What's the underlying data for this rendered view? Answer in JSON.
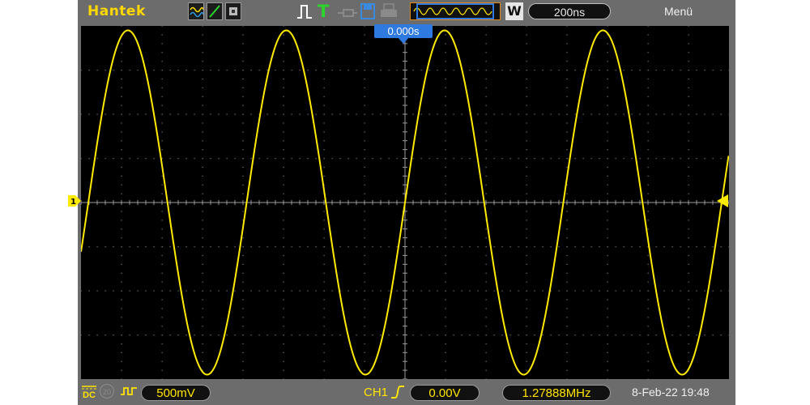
{
  "brand": "Hantek",
  "top_bar": {
    "timebase": "200ns",
    "menu_label": "Menü",
    "window_label": "W",
    "icons": [
      "waveform-icon",
      "slope-icon",
      "symbol-icon",
      "pulse-icon",
      "trigger-t-icon",
      "probe-icon",
      "save-icon",
      "print-icon",
      "memory-icon"
    ]
  },
  "trigger_position_label": "0.000s",
  "channel_marker_label": "1",
  "bottom_bar": {
    "coupling_label": "DC",
    "bw_label": "20",
    "volts_per_div": "500mV",
    "trigger_source": "CH1",
    "trigger_level": "0.00V",
    "frequency": "1.27888MHz",
    "datetime": "8-Feb-22 19:48"
  },
  "colors": {
    "trace": "#ffea00",
    "chrome": "#6c6c6c",
    "screen": "#000000",
    "accent_blue": "#2f7ae0",
    "brand": "#ffd800"
  },
  "chart_data": {
    "type": "line",
    "grid": true,
    "divisions": {
      "x": 16,
      "y": 8
    },
    "series": [
      {
        "type": "sine",
        "frequency_mhz": 1.27888,
        "time_per_div_ns": 200,
        "volts_per_div_mv": 500,
        "amplitude_div": 3.9,
        "phase_at_center": "rising zero-crossing"
      }
    ]
  }
}
